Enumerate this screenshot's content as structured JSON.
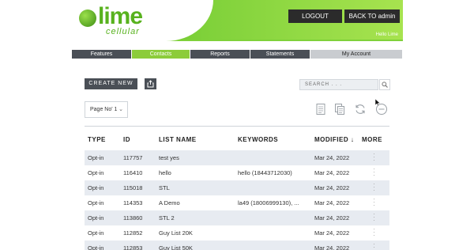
{
  "header": {
    "logo_main": "lime",
    "logo_sub": "cellular",
    "logout_label": "LOGOUT",
    "back_label": "BACK TO admin",
    "greeting": "Hello Lime"
  },
  "nav": {
    "items": [
      {
        "label": "Features",
        "active": false
      },
      {
        "label": "Contacts",
        "active": true
      },
      {
        "label": "Reports",
        "active": false
      },
      {
        "label": "Statements",
        "active": false
      },
      {
        "label": "My Account",
        "active": false
      }
    ]
  },
  "toolbar": {
    "create_label": "CREATE NEW",
    "search_placeholder": "SEARCH . . .",
    "pager_label": "Page No' 1"
  },
  "table": {
    "headers": {
      "type": "TYPE",
      "id": "ID",
      "name": "LIST NAME",
      "keywords": "KEYWORDS",
      "modified": "MODIFIED ↓",
      "more": "MORE"
    },
    "rows": [
      {
        "type": "Opt-in",
        "id": "117757",
        "name": "test yes",
        "keywords": "",
        "modified": "Mar 24, 2022"
      },
      {
        "type": "Opt-in",
        "id": "116410",
        "name": "hello",
        "keywords": "hello (18443712030)",
        "modified": "Mar 24, 2022"
      },
      {
        "type": "Opt-in",
        "id": "115018",
        "name": "STL",
        "keywords": "",
        "modified": "Mar 24, 2022"
      },
      {
        "type": "Opt-in",
        "id": "114353",
        "name": "A Demo",
        "keywords": "la49 (18006999130), ...",
        "modified": "Mar 24, 2022"
      },
      {
        "type": "Opt-in",
        "id": "113860",
        "name": "STL 2",
        "keywords": "",
        "modified": "Mar 24, 2022"
      },
      {
        "type": "Opt-in",
        "id": "112852",
        "name": "Guy List 20K",
        "keywords": "",
        "modified": "Mar 24, 2022"
      },
      {
        "type": "Opt-in",
        "id": "112853",
        "name": "Guy List 50K",
        "keywords": "",
        "modified": "Mar 24, 2022"
      }
    ]
  },
  "colors": {
    "brand_green": "#7fd13a",
    "nav_dark": "#4a4f56",
    "nav_active": "#8ccc3a",
    "nav_light": "#c9ccd0",
    "row_alt": "#e7ebf1"
  }
}
